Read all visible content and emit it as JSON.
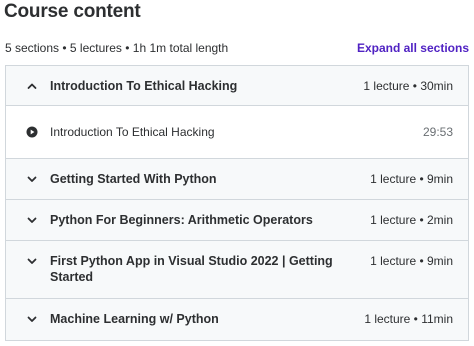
{
  "header": {
    "title": "Course content",
    "summary": "5 sections • 5 lectures • 1h 1m total length",
    "expand_all_label": "Expand all sections"
  },
  "sections": [
    {
      "title": "Introduction To Ethical Hacking",
      "meta": "1 lecture • 30min",
      "expanded": true,
      "chevron": "chevron-up-icon",
      "lectures": [
        {
          "title": "Introduction To Ethical Hacking",
          "duration": "29:53",
          "icon": "play-circle-icon"
        }
      ]
    },
    {
      "title": "Getting Started With Python",
      "meta": "1 lecture • 9min",
      "expanded": false,
      "chevron": "chevron-down-icon"
    },
    {
      "title": "Python For Beginners: Arithmetic Operators",
      "meta": "1 lecture • 2min",
      "expanded": false,
      "chevron": "chevron-down-icon"
    },
    {
      "title": "First Python App in Visual Studio 2022 | Getting Started",
      "meta": "1 lecture • 9min",
      "expanded": false,
      "chevron": "chevron-down-icon"
    },
    {
      "title": "Machine Learning w/ Python",
      "meta": "1 lecture • 11min",
      "expanded": false,
      "chevron": "chevron-down-icon"
    }
  ],
  "colors": {
    "text": "#2d2f31",
    "link": "#5022c3",
    "header_bg": "#f7f9fa",
    "border": "#d1d7dc",
    "muted": "#6a6f73"
  }
}
